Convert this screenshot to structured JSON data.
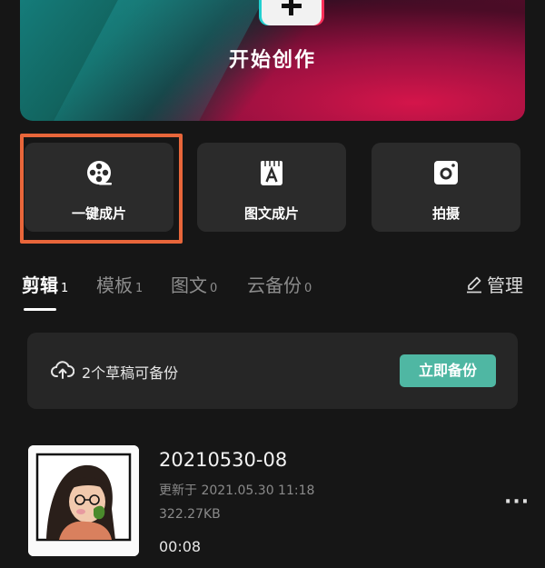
{
  "hero": {
    "title": "开始创作",
    "icon": "plus-icon"
  },
  "quick_actions": [
    {
      "label": "一键成片",
      "icon": "film-reel-icon"
    },
    {
      "label": "图文成片",
      "icon": "text-to-video-icon"
    },
    {
      "label": "拍摄",
      "icon": "camera-icon"
    }
  ],
  "tabs": [
    {
      "label": "剪辑",
      "count": "1"
    },
    {
      "label": "模板",
      "count": "1"
    },
    {
      "label": "图文",
      "count": "0"
    },
    {
      "label": "云备份",
      "count": "0"
    }
  ],
  "manage": {
    "label": "管理",
    "icon": "edit-icon"
  },
  "backup_banner": {
    "message": "2个草稿可备份",
    "button": "立即备份",
    "icon": "cloud-upload-icon"
  },
  "project": {
    "title": "20210530-08",
    "updated": "更新于 2021.05.30 11:18",
    "size": "322.27KB",
    "duration": "00:08",
    "more_icon": "more-icon",
    "more_glyph": "···"
  },
  "colors": {
    "background": "#161616",
    "tile": "#2b2b2b",
    "accent": "#4fb7a3",
    "highlight": "#e8663a"
  }
}
